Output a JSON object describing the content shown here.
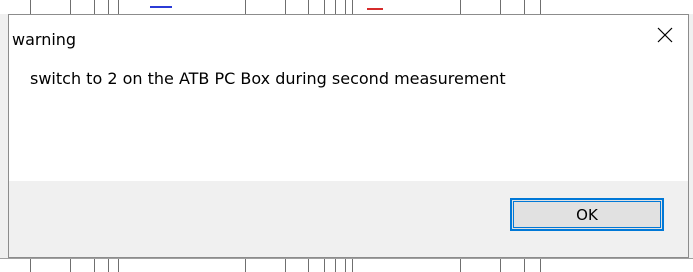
{
  "dialog": {
    "title": "warning",
    "message": "switch to 2 on the ATB PC Box during second measurement",
    "ok_label": "OK",
    "close_icon": "close-icon"
  },
  "colors": {
    "button_focus": "#0078d7",
    "button_face": "#e1e1e1",
    "footer_bg": "#f0f0f0",
    "plot_blue": "#2b3bd6",
    "plot_red": "#d62b2b"
  }
}
